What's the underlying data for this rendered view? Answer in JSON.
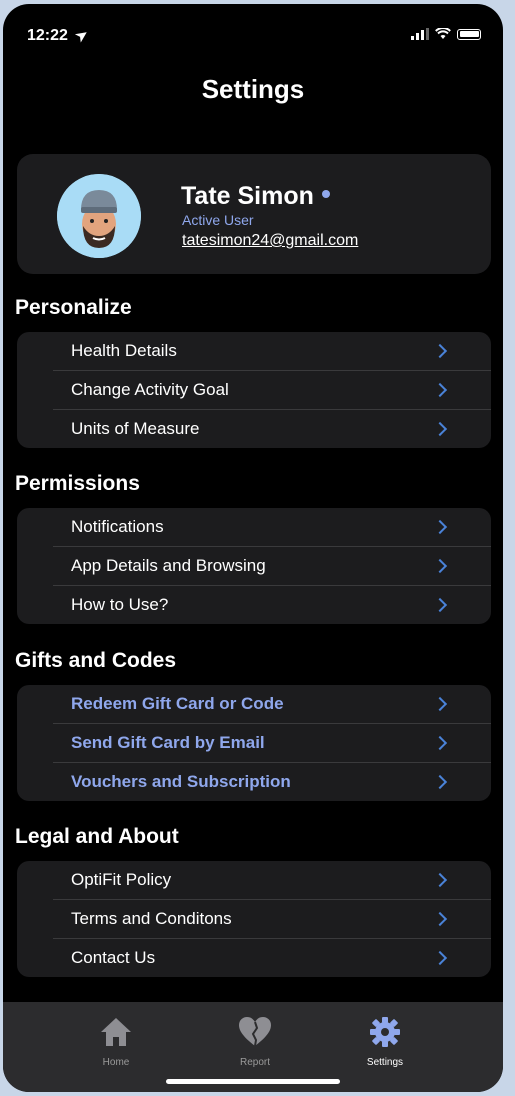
{
  "status": {
    "time": "12:22"
  },
  "header": {
    "title": "Settings"
  },
  "profile": {
    "name": "Tate Simon",
    "status": "Active User",
    "email": "tatesimon24@gmail.com"
  },
  "sections": {
    "personalize": {
      "title": "Personalize",
      "items": [
        "Health Details",
        "Change Activity Goal",
        "Units of Measure"
      ]
    },
    "permissions": {
      "title": "Permissions",
      "items": [
        "Notifications",
        "App Details and Browsing",
        "How to Use?"
      ]
    },
    "gifts": {
      "title": "Gifts and Codes",
      "items": [
        "Redeem Gift Card or Code",
        "Send Gift Card by Email",
        "Vouchers and Subscription"
      ]
    },
    "legal": {
      "title": "Legal and About",
      "items": [
        "OptiFit Policy",
        "Terms and Conditons",
        "Contact Us"
      ]
    }
  },
  "tabbar": {
    "home": "Home",
    "report": "Report",
    "settings": "Settings"
  },
  "colors": {
    "accent": "#8fa7ec",
    "chevron": "#4a82d8",
    "card": "#1c1c1e"
  }
}
